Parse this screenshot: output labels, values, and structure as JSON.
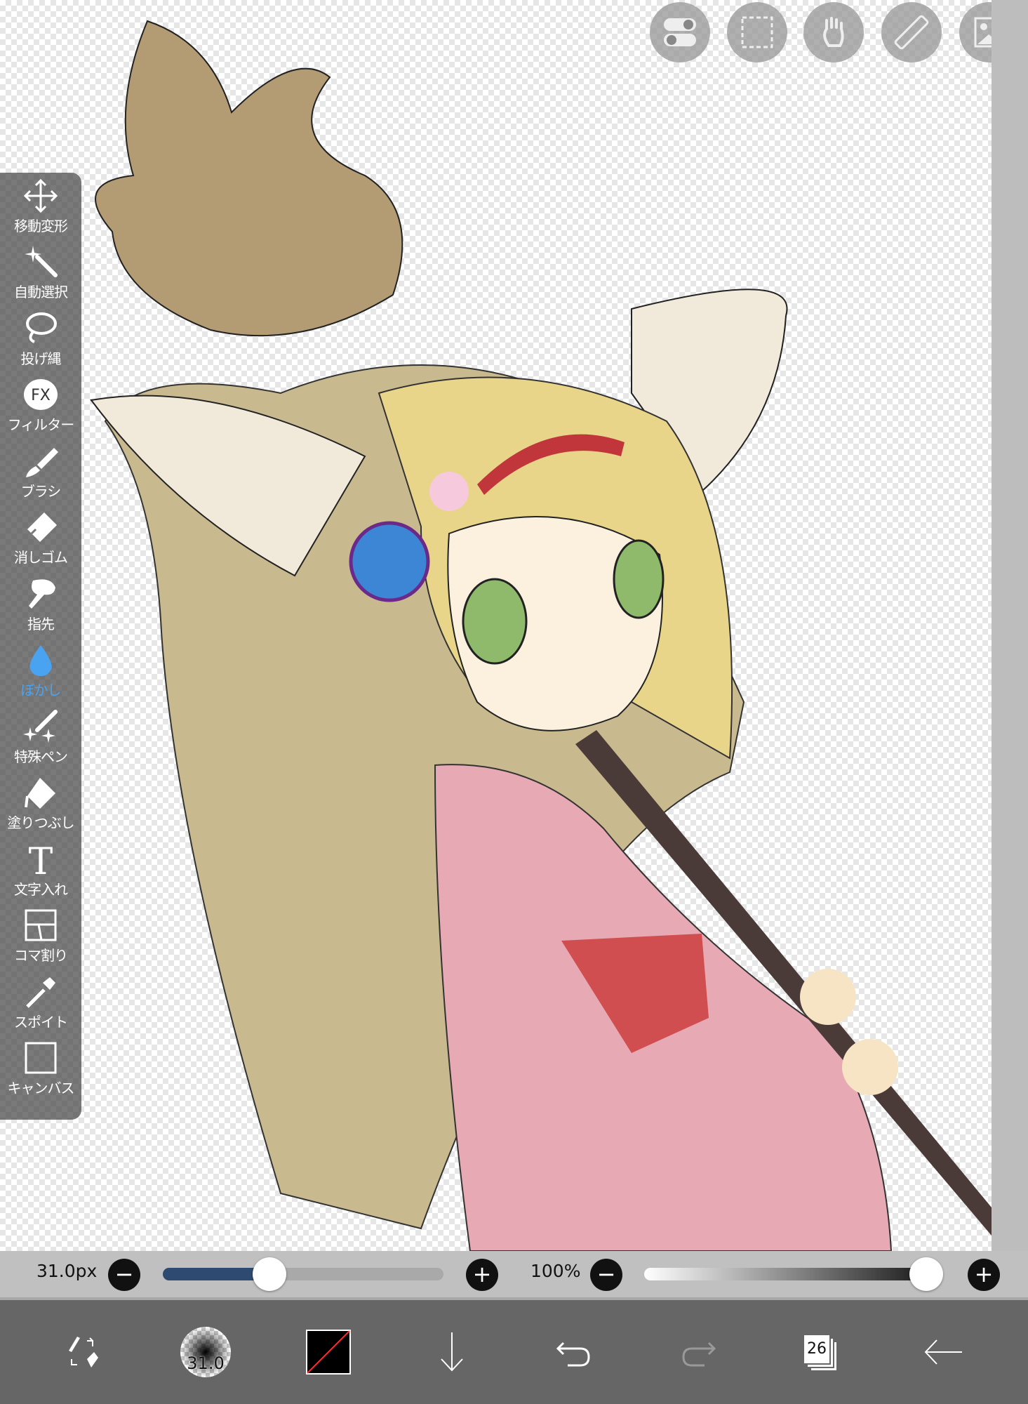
{
  "sidebar": {
    "tools": [
      {
        "label": "移動変形",
        "icon": "move-transform-icon"
      },
      {
        "label": "自動選択",
        "icon": "magic-wand-icon"
      },
      {
        "label": "投げ縄",
        "icon": "lasso-icon"
      },
      {
        "label": "フィルター",
        "icon": "fx-filter-icon",
        "glyph": "FX"
      },
      {
        "label": "ブラシ",
        "icon": "brush-icon"
      },
      {
        "label": "消しゴム",
        "icon": "eraser-icon"
      },
      {
        "label": "指先",
        "icon": "finger-smudge-icon"
      },
      {
        "label": "ぼかし",
        "icon": "blur-drop-icon",
        "active": true
      },
      {
        "label": "特殊ペン",
        "icon": "special-pen-icon"
      },
      {
        "label": "塗りつぶし",
        "icon": "fill-bucket-icon"
      },
      {
        "label": "文字入れ",
        "icon": "text-icon",
        "glyph": "T"
      },
      {
        "label": "コマ割り",
        "icon": "panel-divide-icon"
      },
      {
        "label": "スポイト",
        "icon": "eyedropper-icon"
      },
      {
        "label": "キャンバス",
        "icon": "canvas-icon"
      }
    ]
  },
  "top_buttons": [
    "toggle-icon",
    "selection-icon",
    "hand-icon",
    "ruler-icon",
    "image-icon"
  ],
  "sliders": {
    "size_value": "31.0px",
    "size_fraction": 0.38,
    "opacity_value": "100%",
    "opacity_fraction": 1.0,
    "minus": "−",
    "plus": "+"
  },
  "bottom": {
    "brush_size": "31.0",
    "layer_count": "26",
    "accent": "#2f4a70"
  }
}
